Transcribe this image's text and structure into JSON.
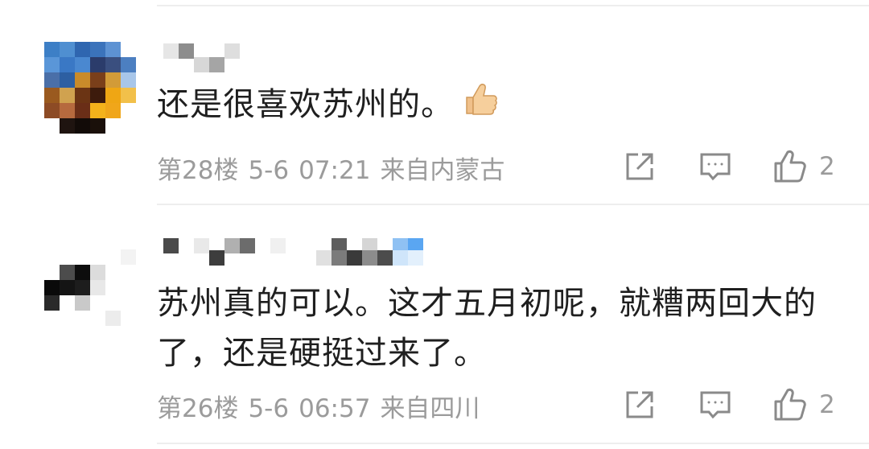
{
  "comments": [
    {
      "text": "还是很喜欢苏州的。",
      "emoji": "thumbs-up",
      "floor": "第28楼",
      "date": "5-6",
      "time": "07:21",
      "location": "来自内蒙古",
      "likes": "2"
    },
    {
      "text": "苏州真的可以。这才五月初呢，就糟两回大的了，还是硬挺过来了。",
      "floor": "第26楼",
      "date": "5-6",
      "time": "06:57",
      "location": "来自四川",
      "likes": "2"
    }
  ],
  "icons": {
    "share": "share-icon",
    "reply": "comment-icon",
    "like": "thumbs-up-icon"
  },
  "colors": {
    "meta_text": "#9b9b9b",
    "body_text": "#1f1f1f",
    "divider": "#eeeeee"
  }
}
